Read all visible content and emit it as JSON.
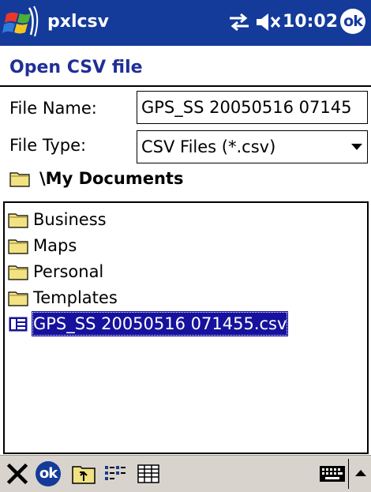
{
  "titlebar": {
    "app_name": "pxlcsv",
    "clock": "10:02",
    "ok_label": "ok"
  },
  "dialog": {
    "title": "Open CSV file",
    "file_name_label": "File Name:",
    "file_name_value": "GPS_SS 20050516 07145",
    "file_type_label": "File Type:",
    "file_type_value": "CSV Files (*.csv)",
    "current_folder": "\\My Documents"
  },
  "file_list": {
    "items": [
      {
        "name": "Business",
        "kind": "folder"
      },
      {
        "name": "Maps",
        "kind": "folder"
      },
      {
        "name": "Personal",
        "kind": "folder"
      },
      {
        "name": "Templates",
        "kind": "folder"
      },
      {
        "name": "GPS_SS 20050516 071455.csv",
        "kind": "file",
        "selected": true
      }
    ]
  },
  "toolbar": {
    "ok_label": "ok",
    "icons": [
      "close-icon",
      "ok-icon",
      "up-folder-icon",
      "list-view-icon",
      "details-view-icon",
      "keyboard-icon",
      "sip-up-arrow-icon"
    ]
  },
  "colors": {
    "titlebar": "#143a9a",
    "heading": "#1f2f97",
    "selection": "#16129d",
    "toolbar": "#d8d4cd",
    "folder_fill": "#f2e281"
  }
}
